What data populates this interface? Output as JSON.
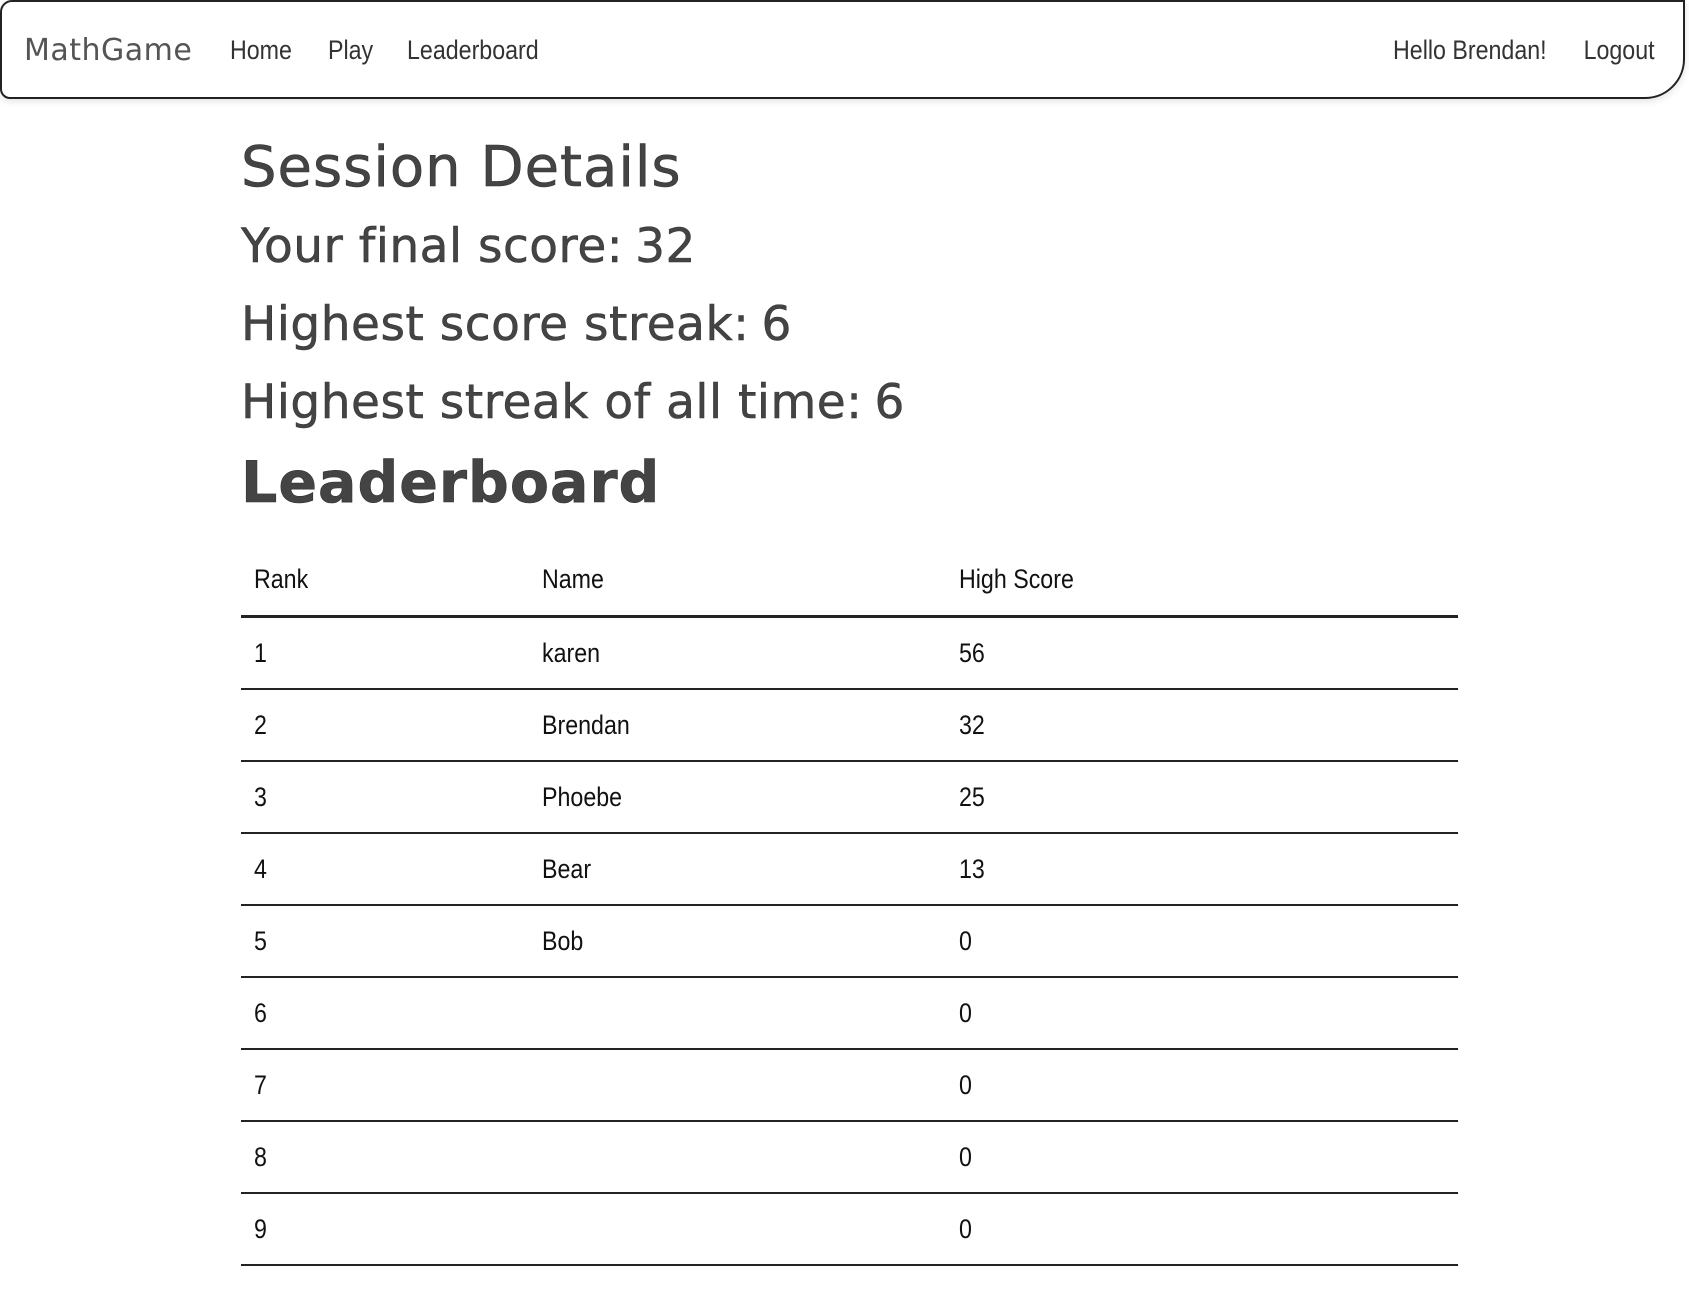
{
  "navbar": {
    "brand": "MathGame",
    "links": [
      "Home",
      "Play",
      "Leaderboard"
    ],
    "greeting": "Hello Brendan!",
    "logout": "Logout"
  },
  "session": {
    "title": "Session Details",
    "final_score_label": "Your final score:",
    "final_score": "32",
    "streak_label": "Highest score streak:",
    "streak": "6",
    "all_time_label": "Highest streak of all time:",
    "all_time": "6"
  },
  "leaderboard": {
    "title": "Leaderboard",
    "columns": [
      "Rank",
      "Name",
      "High Score"
    ],
    "rows": [
      {
        "rank": "1",
        "name": "karen",
        "score": "56"
      },
      {
        "rank": "2",
        "name": "Brendan",
        "score": "32"
      },
      {
        "rank": "3",
        "name": "Phoebe",
        "score": "25"
      },
      {
        "rank": "4",
        "name": "Bear",
        "score": "13"
      },
      {
        "rank": "5",
        "name": "Bob",
        "score": "0"
      },
      {
        "rank": "6",
        "name": "",
        "score": "0"
      },
      {
        "rank": "7",
        "name": "",
        "score": "0"
      },
      {
        "rank": "8",
        "name": "",
        "score": "0"
      },
      {
        "rank": "9",
        "name": "",
        "score": "0"
      }
    ]
  }
}
